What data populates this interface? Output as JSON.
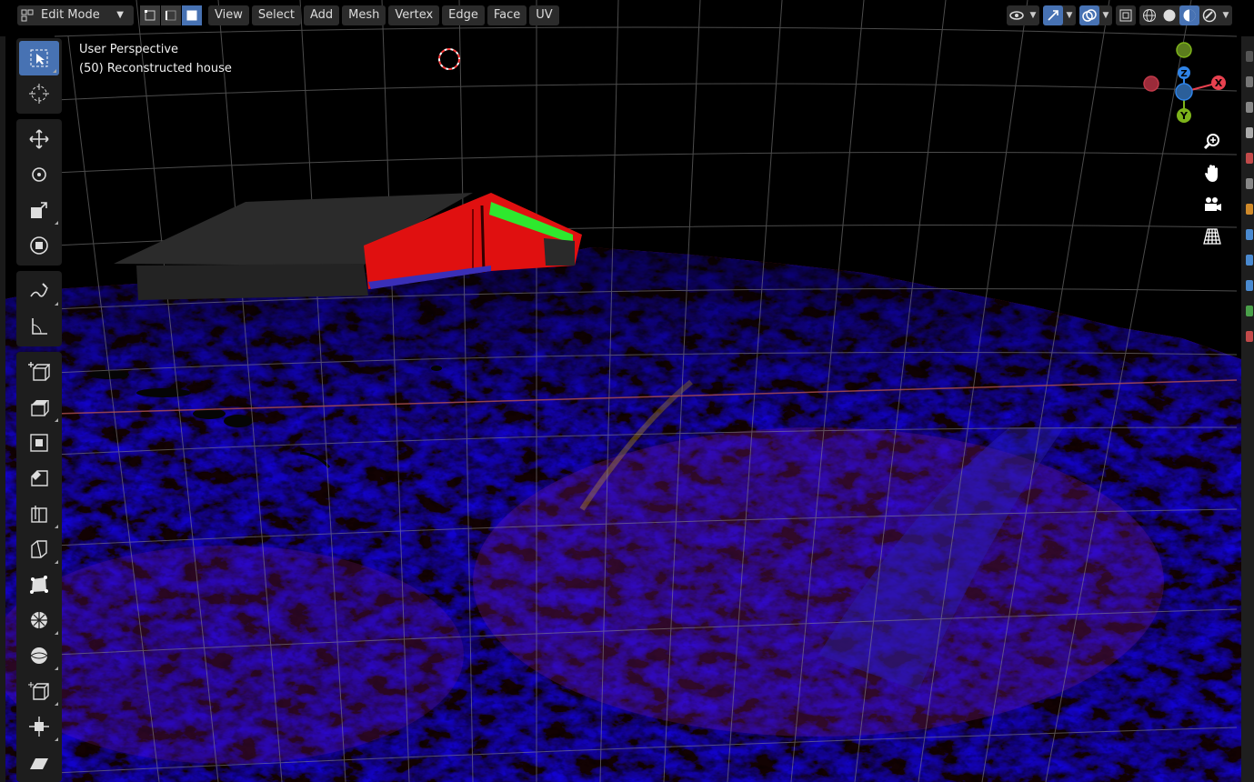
{
  "header": {
    "mode": "Edit Mode",
    "menus": [
      "View",
      "Select",
      "Add",
      "Mesh",
      "Vertex",
      "Edge",
      "Face",
      "UV"
    ],
    "select_modes": [
      "vertex-select-icon",
      "edge-select-icon",
      "face-select-icon"
    ],
    "active_select_mode": "face"
  },
  "viewport": {
    "perspective": "User Perspective",
    "object_info": "(50) Reconstructed house"
  },
  "gizmo": {
    "axes": [
      "X",
      "Y",
      "Z"
    ],
    "colors": {
      "x": "#e8414f",
      "y": "#7db31a",
      "z": "#2f83e6"
    }
  },
  "toolbar": {
    "tools": [
      "select-box-icon",
      "cursor-icon",
      "move-icon",
      "rotate-icon",
      "scale-icon",
      "transform-icon",
      "annotate-icon",
      "measure-icon",
      "add-cube-icon",
      "extrude-icon",
      "inset-icon",
      "bevel-icon",
      "loop-cut-icon",
      "knife-icon",
      "poly-build-icon",
      "spin-icon",
      "smooth-icon",
      "edge-slide-icon",
      "shrink-fatten-icon",
      "shear-icon"
    ]
  },
  "colors": {
    "accent": "#4772b3",
    "terrain_red": "#c4202a",
    "terrain_blue": "#3a2fa8",
    "house_red": "#e01010",
    "house_green": "#2ee82e"
  }
}
